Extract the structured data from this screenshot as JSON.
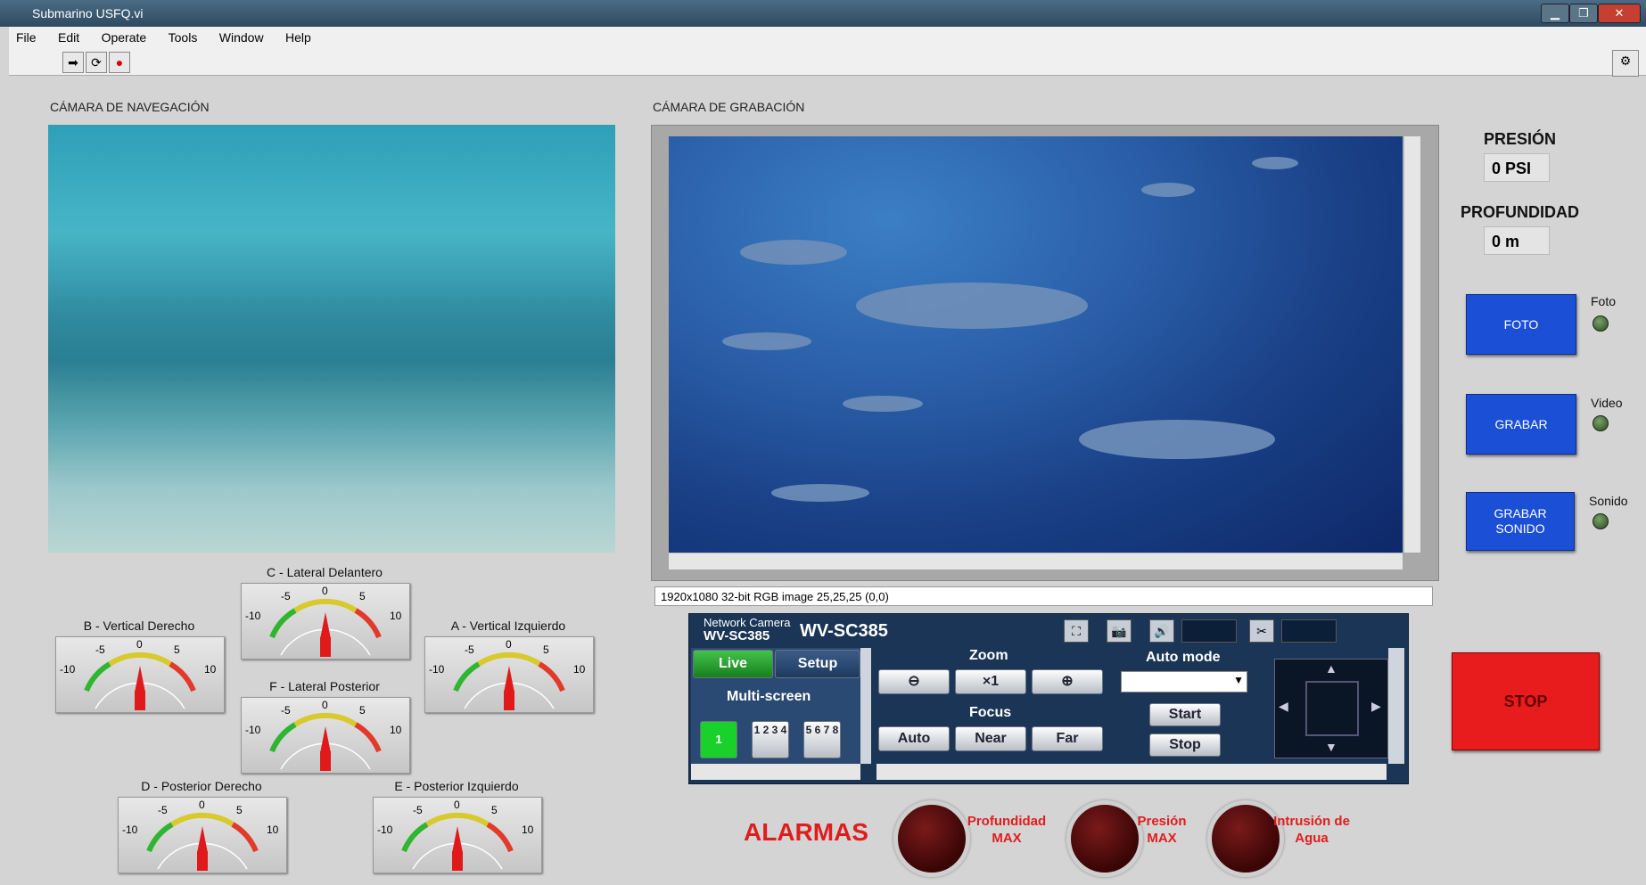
{
  "window": {
    "title": "Submarino USFQ.vi"
  },
  "menu": [
    "File",
    "Edit",
    "Operate",
    "Tools",
    "Window",
    "Help"
  ],
  "nav_camera": {
    "label": "CÁMARA DE NAVEGACIÓN"
  },
  "rec_camera": {
    "label": "CÁMARA DE GRABACIÓN",
    "info": "1920x1080 32-bit RGB image 25,25,25     (0,0)"
  },
  "gauges": [
    {
      "name": "C - Lateral Delantero",
      "value": 0
    },
    {
      "name": "B - Vertical Derecho",
      "value": 0
    },
    {
      "name": "A - Vertical Izquierdo",
      "value": 0
    },
    {
      "name": "F - Lateral Posterior",
      "value": 0
    },
    {
      "name": "D - Posterior Derecho",
      "value": 0
    },
    {
      "name": "E - Posterior Izquierdo",
      "value": 0
    }
  ],
  "gauge_scale": [
    "-10",
    "-5",
    "0",
    "5",
    "10"
  ],
  "network_camera": {
    "small_label": "Network Camera",
    "model_small": "WV-SC385",
    "model": "WV-SC385",
    "live": "Live",
    "setup": "Setup",
    "multiscreen": "Multi-screen",
    "zoom": "Zoom",
    "zoom_reset": "×1",
    "focus": "Focus",
    "focus_auto": "Auto",
    "focus_near": "Near",
    "focus_far": "Far",
    "auto_mode": "Auto mode",
    "start": "Start",
    "stop": "Stop",
    "screen_1": "1",
    "screen_4": "1 2 3 4",
    "screen_8": "5 6 7 8"
  },
  "readouts": {
    "pressure_title": "PRESIÓN",
    "pressure_value": "0 PSI",
    "depth_title": "PROFUNDIDAD",
    "depth_value": "0 m"
  },
  "actions": [
    {
      "button": "FOTO",
      "indicator": "Foto"
    },
    {
      "button": "GRABAR",
      "indicator": "Video"
    },
    {
      "button": "GRABAR SONIDO",
      "indicator": "Sonido"
    }
  ],
  "stop_button": "STOP",
  "alarms": {
    "title": "ALARMAS",
    "items": [
      "Profundidad MAX",
      "Presión MAX",
      "Intrusión de Agua"
    ]
  }
}
